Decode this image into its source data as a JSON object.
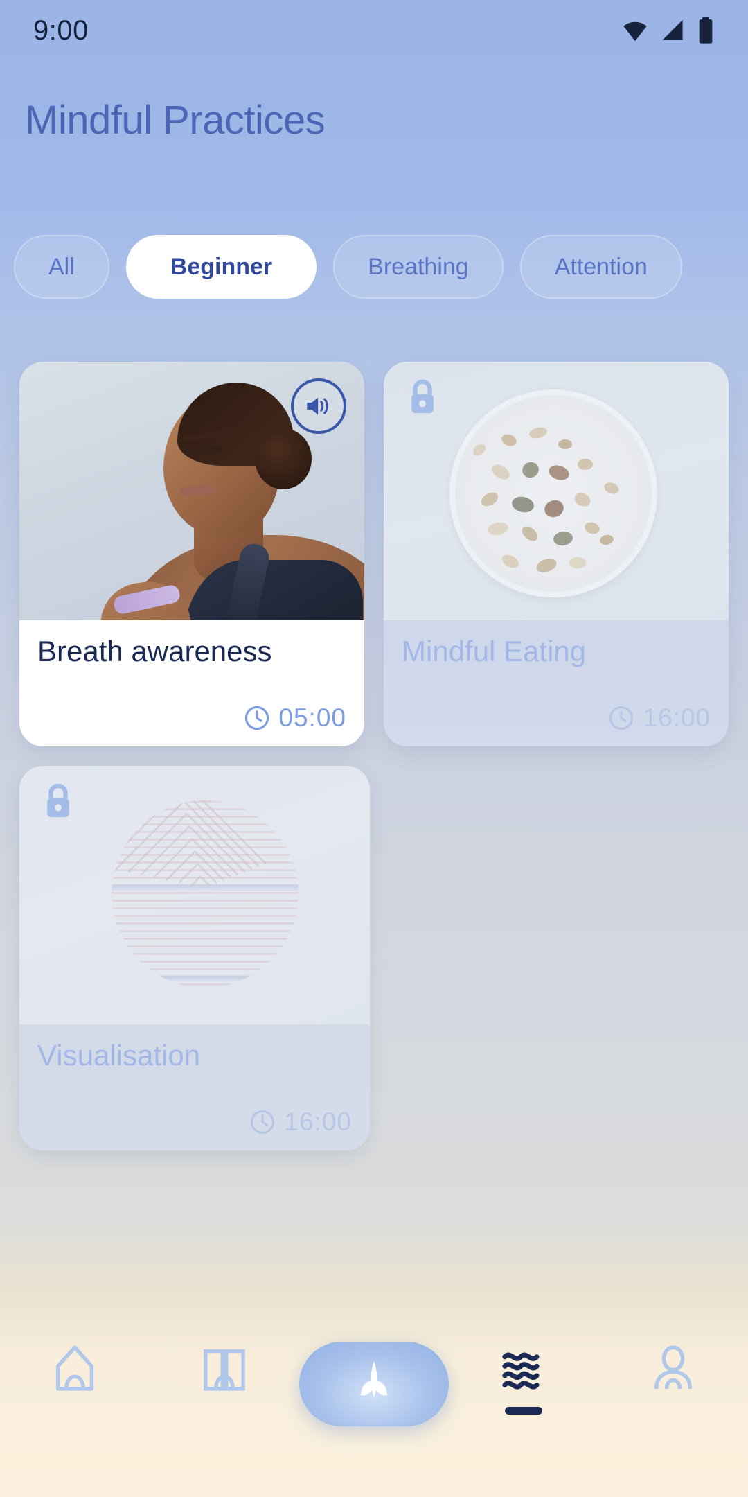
{
  "status_bar": {
    "time": "9:00",
    "icons": [
      "wifi-icon",
      "cellular-signal-icon",
      "battery-icon"
    ]
  },
  "header": {
    "title": "Mindful Practices"
  },
  "filters": {
    "chips": [
      {
        "label": "All",
        "selected": false
      },
      {
        "label": "Beginner",
        "selected": true
      },
      {
        "label": "Breathing",
        "selected": false
      },
      {
        "label": "Attention",
        "selected": false
      }
    ]
  },
  "practices": [
    {
      "title": "Breath awareness",
      "duration": "05:00",
      "locked": false,
      "audio_badge": "volume-icon",
      "image": "woman-meditating-photo"
    },
    {
      "title": "Mindful Eating",
      "duration": "16:00",
      "locked": true,
      "lock_badge": "lock-icon",
      "image": "granola-bowl-photo"
    },
    {
      "title": "Visualisation",
      "duration": "16:00",
      "locked": true,
      "lock_badge": "lock-icon",
      "image": "abstract-concentric-circle"
    }
  ],
  "bottom_nav": {
    "items": [
      {
        "name": "home",
        "icon": "home-icon",
        "active": false
      },
      {
        "name": "library",
        "icon": "book-icon",
        "active": false
      },
      {
        "name": "meditate",
        "icon": "sprout-icon",
        "active": false,
        "is_fab": true
      },
      {
        "name": "sounds",
        "icon": "waves-icon",
        "active": true
      },
      {
        "name": "profile",
        "icon": "person-icon",
        "active": false
      }
    ]
  },
  "colors": {
    "background_top": "#9ab5e6",
    "background_bottom": "#faf0dd",
    "title": "#4a66b5",
    "chip_active_bg": "#ffffff",
    "chip_active_text": "#32499b",
    "card_title": "#1b2a55",
    "locked_text": "#7b9ae0",
    "duration": "#7c9ae0",
    "accent": "#8fb0e4",
    "nav_active": "#1b2a55"
  }
}
